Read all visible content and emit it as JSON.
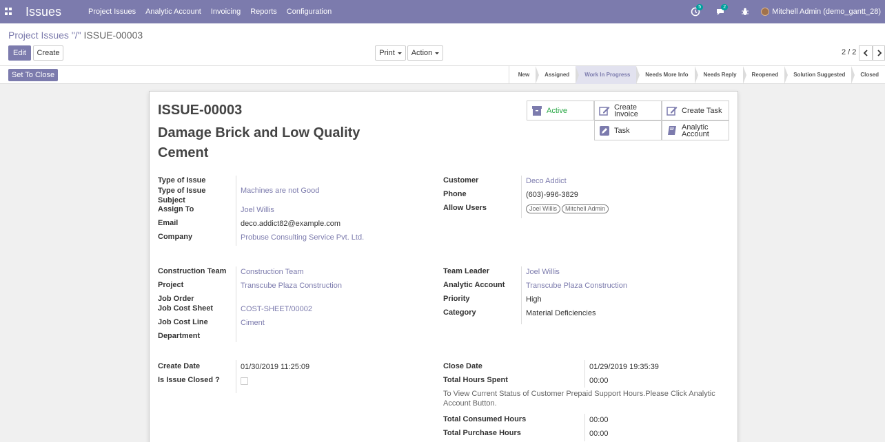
{
  "app": {
    "title": "Issues"
  },
  "menu": [
    "Project Issues",
    "Analytic Account",
    "Invoicing",
    "Reports",
    "Configuration"
  ],
  "systray": {
    "activity_count": "5",
    "messages_count": "2",
    "user_name": "Mitchell Admin (demo_gantt_28)"
  },
  "breadcrumb": {
    "parent": "Project Issues \"/\"",
    "current": " ISSUE-00003"
  },
  "buttons": {
    "edit": "Edit",
    "create": "Create",
    "print": "Print",
    "action": "Action",
    "set_to_close": "Set To Close"
  },
  "pager": {
    "value": "2 / 2"
  },
  "stages": [
    "New",
    "Assigned",
    "Work In Progress",
    "Needs More Info",
    "Needs Reply",
    "Reopened",
    "Solution Suggested",
    "Closed"
  ],
  "active_stage": "Work In Progress",
  "smart_buttons": {
    "active": "Active",
    "create_invoice": "Create Invoice",
    "create_task": "Create Task",
    "task": "Task",
    "analytic_account_line1": "Analytic",
    "analytic_account_line2": "Account"
  },
  "issue": {
    "reference": "ISSUE-00003",
    "name": "Damage Brick and Low Quality Cement"
  },
  "left_group_1": {
    "type_of_issue_label": "Type of Issue",
    "type_of_issue_subject_label": "Type of Issue Subject",
    "type_of_issue_subject_value": "Machines are not Good",
    "assign_to_label": "Assign To",
    "assign_to_value": "Joel Willis",
    "email_label": "Email",
    "email_value": "deco.addict82@example.com",
    "company_label": "Company",
    "company_value": "Probuse Consulting Service Pvt. Ltd."
  },
  "right_group_1": {
    "customer_label": "Customer",
    "customer_value": "Deco Addict",
    "phone_label": "Phone",
    "phone_value": "(603)-996-3829",
    "allow_users_label": "Allow Users",
    "allow_users": [
      "Joel Willis",
      "Mitchell Admin"
    ]
  },
  "left_group_2": {
    "construction_team_label": "Construction Team",
    "construction_team_value": "Construction Team",
    "project_label": "Project",
    "project_value": "Transcube Plaza Construction",
    "job_order_label": "Job Order",
    "job_cost_sheet_label": "Job Cost Sheet",
    "job_cost_sheet_value": "COST-SHEET/00002",
    "job_cost_line_label": "Job Cost Line",
    "job_cost_line_value": "Ciment",
    "department_label": "Department"
  },
  "right_group_2": {
    "team_leader_label": "Team Leader",
    "team_leader_value": "Joel Willis",
    "analytic_account_label": "Analytic Account",
    "analytic_account_value": "Transcube Plaza Construction",
    "priority_label": "Priority",
    "priority_value": "High",
    "category_label": "Category",
    "category_value": "Material Deficiencies"
  },
  "left_group_3": {
    "create_date_label": "Create Date",
    "create_date_value": "01/30/2019 11:25:09",
    "is_issue_closed_label": "Is Issue Closed ?"
  },
  "right_group_3": {
    "close_date_label": "Close Date",
    "close_date_value": "01/29/2019 19:35:39",
    "total_hours_spent_label": "Total Hours Spent",
    "total_hours_spent_value": "00:00",
    "help_text": "To View Current Status of Customer Prepaid Support Hours.Please Click Analytic Account Button.",
    "total_consumed_hours_label": "Total Consumed Hours",
    "total_consumed_hours_value": "00:00",
    "total_purchase_hours_label": "Total Purchase Hours",
    "total_purchase_hours_value": "00:00"
  },
  "colors": {
    "brand": "#7c7bad",
    "active_green": "#28a745"
  }
}
